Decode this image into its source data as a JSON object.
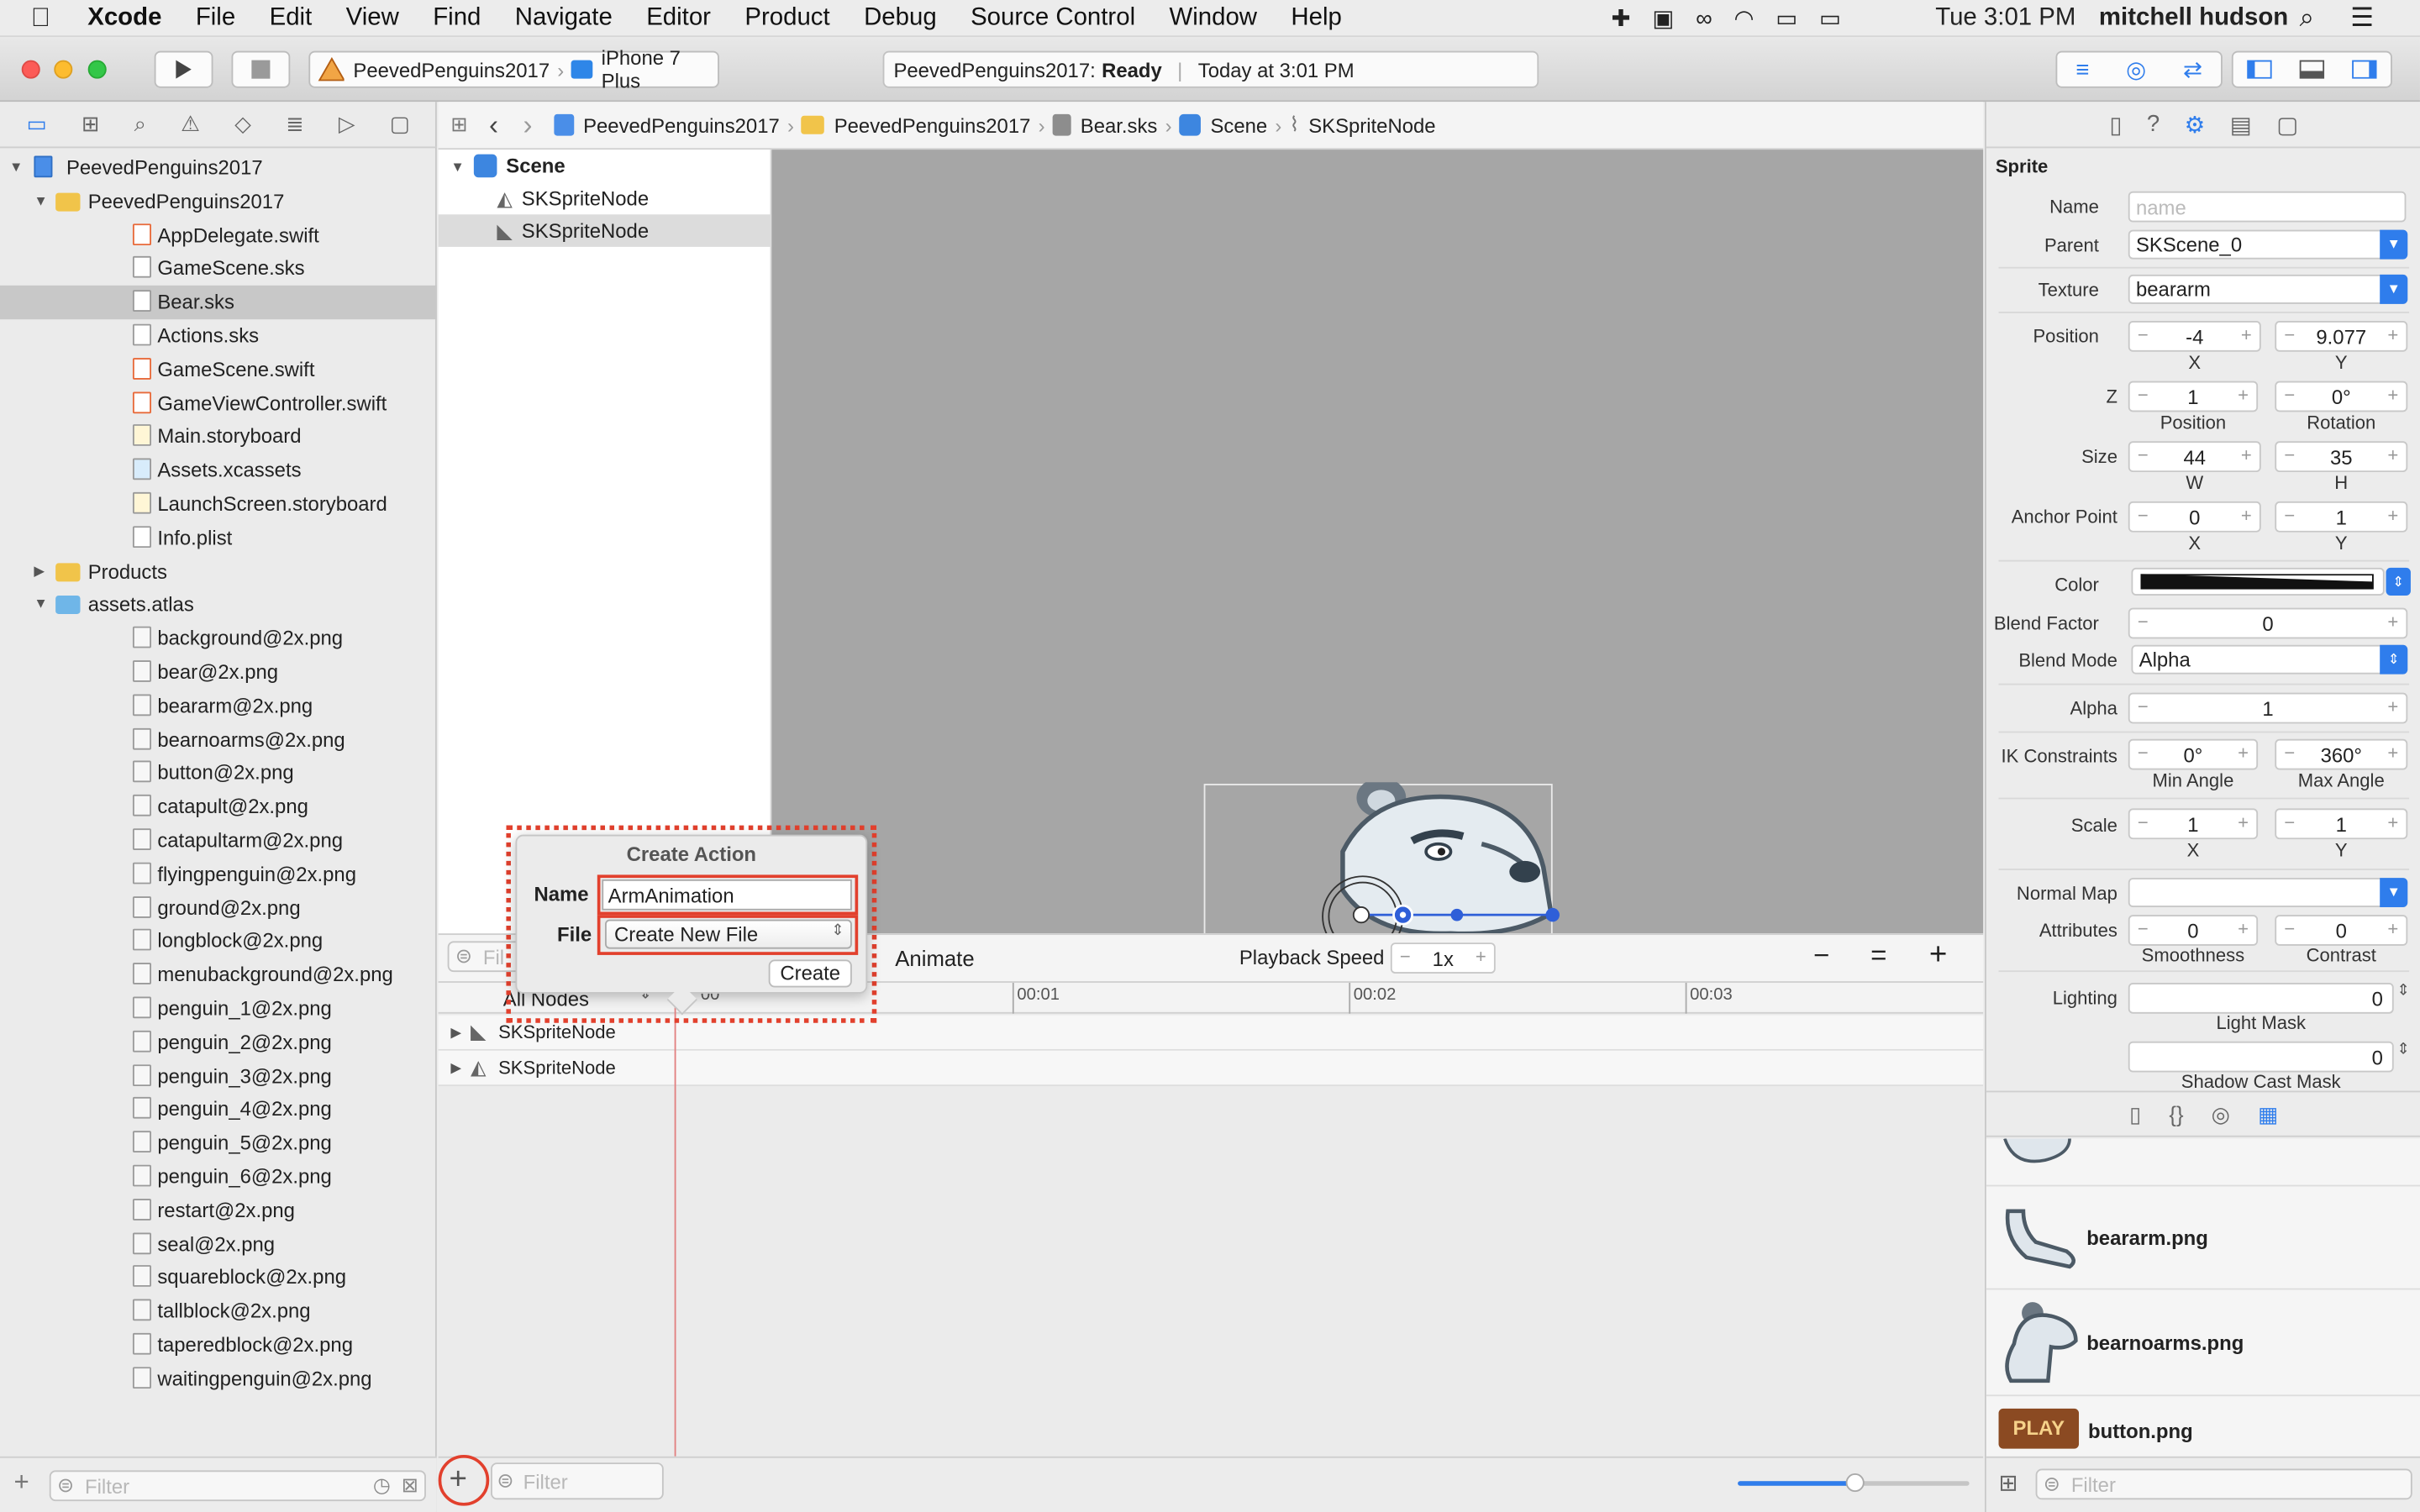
{
  "menubar": {
    "apple_icon": "apple-icon",
    "items": [
      "Xcode",
      "File",
      "Edit",
      "View",
      "Find",
      "Navigate",
      "Editor",
      "Product",
      "Debug",
      "Source Control",
      "Window",
      "Help"
    ],
    "clock": "Tue 3:01 PM",
    "user": "mitchell hudson"
  },
  "toolbar": {
    "scheme": "PeevedPenguins2017",
    "device": "iPhone 7 Plus",
    "status_project": "PeevedPenguins2017:",
    "status_state": "Ready",
    "status_time": "Today at 3:01 PM"
  },
  "navigator": {
    "rows": [
      {
        "label": "PeevedPenguins2017",
        "indent": 0,
        "kind": "project",
        "open": true
      },
      {
        "label": "PeevedPenguins2017",
        "indent": 1,
        "kind": "folder",
        "open": true
      },
      {
        "label": "AppDelegate.swift",
        "indent": 2,
        "kind": "swift"
      },
      {
        "label": "GameScene.sks",
        "indent": 2,
        "kind": "sks"
      },
      {
        "label": "Bear.sks",
        "indent": 2,
        "kind": "sks",
        "selected": true
      },
      {
        "label": "Actions.sks",
        "indent": 2,
        "kind": "sks"
      },
      {
        "label": "GameScene.swift",
        "indent": 2,
        "kind": "swift"
      },
      {
        "label": "GameViewController.swift",
        "indent": 2,
        "kind": "swift"
      },
      {
        "label": "Main.storyboard",
        "indent": 2,
        "kind": "storyboard"
      },
      {
        "label": "Assets.xcassets",
        "indent": 2,
        "kind": "assets"
      },
      {
        "label": "LaunchScreen.storyboard",
        "indent": 2,
        "kind": "storyboard"
      },
      {
        "label": "Info.plist",
        "indent": 2,
        "kind": "plist"
      },
      {
        "label": "Products",
        "indent": 1,
        "kind": "folder",
        "open": false
      },
      {
        "label": "assets.atlas",
        "indent": 1,
        "kind": "bluefolder",
        "open": true
      },
      {
        "label": "background@2x.png",
        "indent": 2,
        "kind": "png"
      },
      {
        "label": "bear@2x.png",
        "indent": 2,
        "kind": "png"
      },
      {
        "label": "beararm@2x.png",
        "indent": 2,
        "kind": "png"
      },
      {
        "label": "bearnoarms@2x.png",
        "indent": 2,
        "kind": "png"
      },
      {
        "label": "button@2x.png",
        "indent": 2,
        "kind": "png"
      },
      {
        "label": "catapult@2x.png",
        "indent": 2,
        "kind": "png"
      },
      {
        "label": "catapultarm@2x.png",
        "indent": 2,
        "kind": "png"
      },
      {
        "label": "flyingpenguin@2x.png",
        "indent": 2,
        "kind": "png"
      },
      {
        "label": "ground@2x.png",
        "indent": 2,
        "kind": "png"
      },
      {
        "label": "longblock@2x.png",
        "indent": 2,
        "kind": "png"
      },
      {
        "label": "menubackground@2x.png",
        "indent": 2,
        "kind": "png"
      },
      {
        "label": "penguin_1@2x.png",
        "indent": 2,
        "kind": "png"
      },
      {
        "label": "penguin_2@2x.png",
        "indent": 2,
        "kind": "png"
      },
      {
        "label": "penguin_3@2x.png",
        "indent": 2,
        "kind": "png"
      },
      {
        "label": "penguin_4@2x.png",
        "indent": 2,
        "kind": "png"
      },
      {
        "label": "penguin_5@2x.png",
        "indent": 2,
        "kind": "png"
      },
      {
        "label": "penguin_6@2x.png",
        "indent": 2,
        "kind": "png"
      },
      {
        "label": "restart@2x.png",
        "indent": 2,
        "kind": "png"
      },
      {
        "label": "seal@2x.png",
        "indent": 2,
        "kind": "png"
      },
      {
        "label": "squareblock@2x.png",
        "indent": 2,
        "kind": "png"
      },
      {
        "label": "tallblock@2x.png",
        "indent": 2,
        "kind": "png"
      },
      {
        "label": "taperedblock@2x.png",
        "indent": 2,
        "kind": "png"
      },
      {
        "label": "waitingpenguin@2x.png",
        "indent": 2,
        "kind": "png"
      }
    ],
    "filter_placeholder": "Filter"
  },
  "jumpbar": {
    "crumbs": [
      "PeevedPenguins2017",
      "PeevedPenguins2017",
      "Bear.sks",
      "Scene",
      "SKSpriteNode"
    ]
  },
  "scene_tree": {
    "root": "Scene",
    "children": [
      "SKSpriteNode",
      "SKSpriteNode"
    ]
  },
  "anim_bar": {
    "filter_placeholder": "Fil",
    "animate_label": "Animate",
    "playback_label": "Playback Speed",
    "playback_value": "1x"
  },
  "timeline": {
    "nodes_selector": "All Nodes",
    "ticks": [
      "00:01",
      "00:02",
      "00:03"
    ],
    "tracks": [
      "SKSpriteNode",
      "SKSpriteNode"
    ],
    "partial_tick": "00"
  },
  "editor_bottom": {
    "filter_placeholder": "Filter"
  },
  "popover": {
    "title": "Create Action",
    "name_label": "Name",
    "name_value": "ArmAnimation",
    "file_label": "File",
    "file_value": "Create New File",
    "create_button": "Create"
  },
  "inspector": {
    "section": "Sprite",
    "name_label": "Name",
    "name_placeholder": "name",
    "parent_label": "Parent",
    "parent_value": "SKScene_0",
    "texture_label": "Texture",
    "texture_value": "beararm",
    "position_label": "Position",
    "position_x": "-4",
    "position_y": "9.077",
    "x_label": "X",
    "y_label": "Y",
    "z_label": "Z",
    "z_value": "1",
    "rotation_value": "0°",
    "z_sub1": "Position",
    "z_sub2": "Rotation",
    "size_label": "Size",
    "size_w": "44",
    "size_h": "35",
    "w_label": "W",
    "h_label": "H",
    "anchor_label": "Anchor Point",
    "anchor_x": "0",
    "anchor_y": "1",
    "color_label": "Color",
    "blend_factor_label": "Blend Factor",
    "blend_factor_value": "0",
    "blend_mode_label": "Blend Mode",
    "blend_mode_value": "Alpha",
    "alpha_label": "Alpha",
    "alpha_value": "1",
    "ik_label": "IK Constraints",
    "ik_min": "0°",
    "ik_max": "360°",
    "ik_min_label": "Min Angle",
    "ik_max_label": "Max Angle",
    "scale_label": "Scale",
    "scale_x": "1",
    "scale_y": "1",
    "normal_map_label": "Normal Map",
    "attributes_label": "Attributes",
    "smoothness_value": "0",
    "contrast_value": "0",
    "smoothness_label": "Smoothness",
    "contrast_label": "Contrast",
    "lighting_label": "Lighting",
    "light_mask_value": "0",
    "light_mask_label": "Light Mask",
    "shadow_mask_value": "0",
    "shadow_mask_label": "Shadow Cast Mask"
  },
  "library": {
    "items": [
      "beararm.png",
      "bearnoarms.png",
      "button.png"
    ],
    "button_art_text": "PLAY",
    "filter_placeholder": "Filter"
  },
  "colors": {
    "accent": "#2f7dec",
    "highlight": "#e2402d",
    "selection": "#c8c8c8"
  }
}
